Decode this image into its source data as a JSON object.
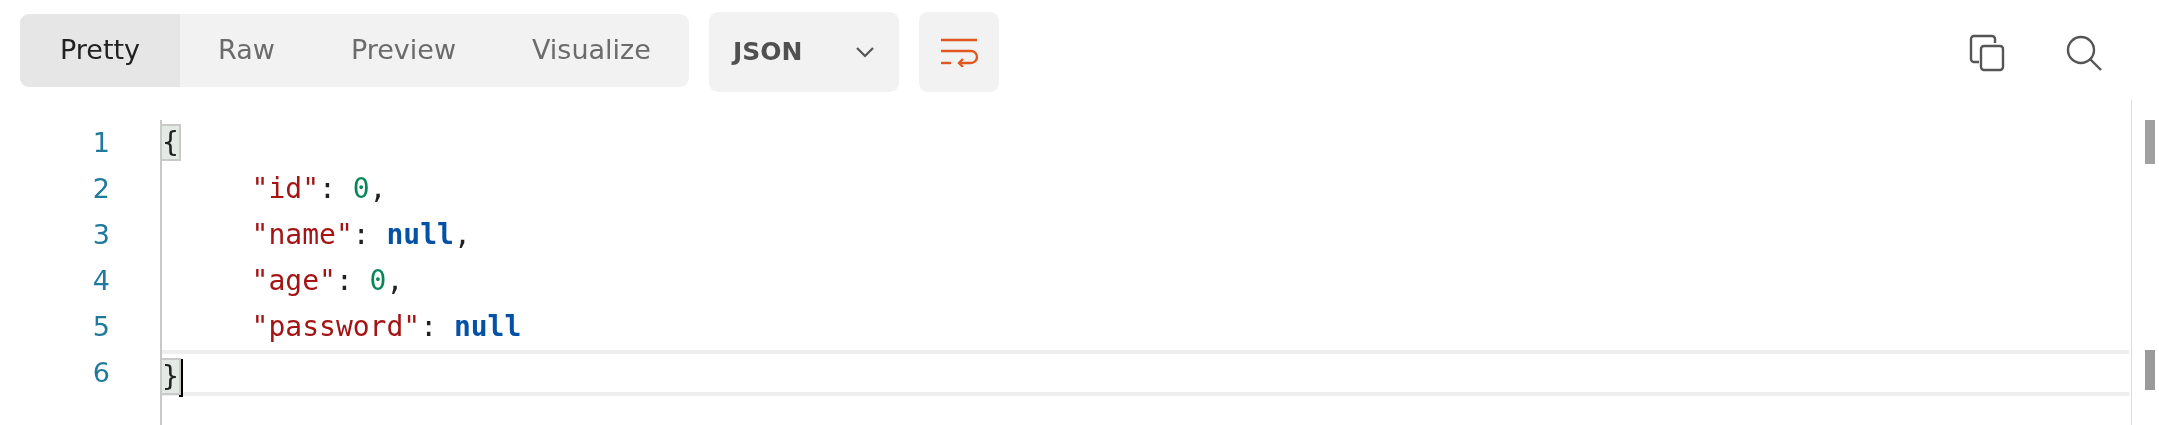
{
  "view_tabs": [
    {
      "label": "Pretty",
      "selected": true
    },
    {
      "label": "Raw",
      "selected": false
    },
    {
      "label": "Preview",
      "selected": false
    },
    {
      "label": "Visualize",
      "selected": false
    }
  ],
  "format_dropdown": {
    "value": "JSON"
  },
  "editor": {
    "lines": [
      {
        "number": "1",
        "current": false,
        "tokens": [
          {
            "kind": "bracket",
            "text": "{",
            "matched": true
          }
        ]
      },
      {
        "number": "2",
        "current": false,
        "tokens": [
          {
            "kind": "key",
            "text": "\"id\""
          },
          {
            "kind": "punct",
            "text": ": "
          },
          {
            "kind": "number",
            "text": "0"
          },
          {
            "kind": "punct",
            "text": ","
          }
        ]
      },
      {
        "number": "3",
        "current": false,
        "tokens": [
          {
            "kind": "key",
            "text": "\"name\""
          },
          {
            "kind": "punct",
            "text": ": "
          },
          {
            "kind": "null",
            "text": "null"
          },
          {
            "kind": "punct",
            "text": ","
          }
        ]
      },
      {
        "number": "4",
        "current": false,
        "tokens": [
          {
            "kind": "key",
            "text": "\"age\""
          },
          {
            "kind": "punct",
            "text": ": "
          },
          {
            "kind": "number",
            "text": "0"
          },
          {
            "kind": "punct",
            "text": ","
          }
        ]
      },
      {
        "number": "5",
        "current": false,
        "tokens": [
          {
            "kind": "key",
            "text": "\"password\""
          },
          {
            "kind": "punct",
            "text": ": "
          },
          {
            "kind": "null",
            "text": "null"
          }
        ]
      },
      {
        "number": "6",
        "current": true,
        "tokens": [
          {
            "kind": "bracket",
            "text": "}",
            "matched": true
          }
        ]
      }
    ]
  }
}
